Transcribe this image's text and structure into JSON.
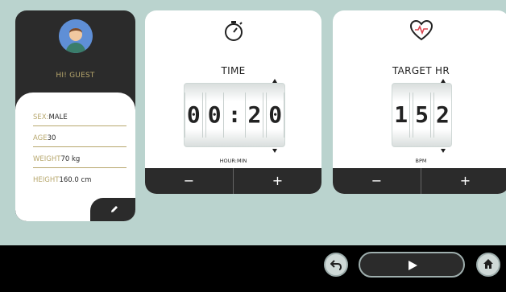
{
  "profile": {
    "greeting": "HI! GUEST",
    "fields": [
      {
        "label": "SEX:",
        "value": "MALE"
      },
      {
        "label": "AGE",
        "value": "30"
      },
      {
        "label": "WEIGHT",
        "value": "70 kg"
      },
      {
        "label": "HEIGHT",
        "value": "160.0 cm"
      }
    ],
    "edit_icon": "pencil-icon",
    "avatar_icon": "user-avatar"
  },
  "time_panel": {
    "icon": "stopwatch-icon",
    "title": "TIME",
    "digits": [
      "0",
      "0",
      ":",
      "2",
      "0"
    ],
    "unit": "HOUR:MIN",
    "minus_label": "−",
    "plus_label": "+"
  },
  "hr_panel": {
    "icon": "heart-rate-icon",
    "title": "TARGET HR",
    "digits": [
      "1",
      "5",
      "2"
    ],
    "unit": "BPM",
    "minus_label": "−",
    "plus_label": "+"
  },
  "bottom_bar": {
    "back_icon": "undo-icon",
    "play_icon": "play-icon",
    "home_icon": "home-icon"
  },
  "colors": {
    "background": "#bad3ce",
    "dark": "#2b2b2b",
    "accent": "#b7a76d",
    "heart": "#d9434f"
  }
}
